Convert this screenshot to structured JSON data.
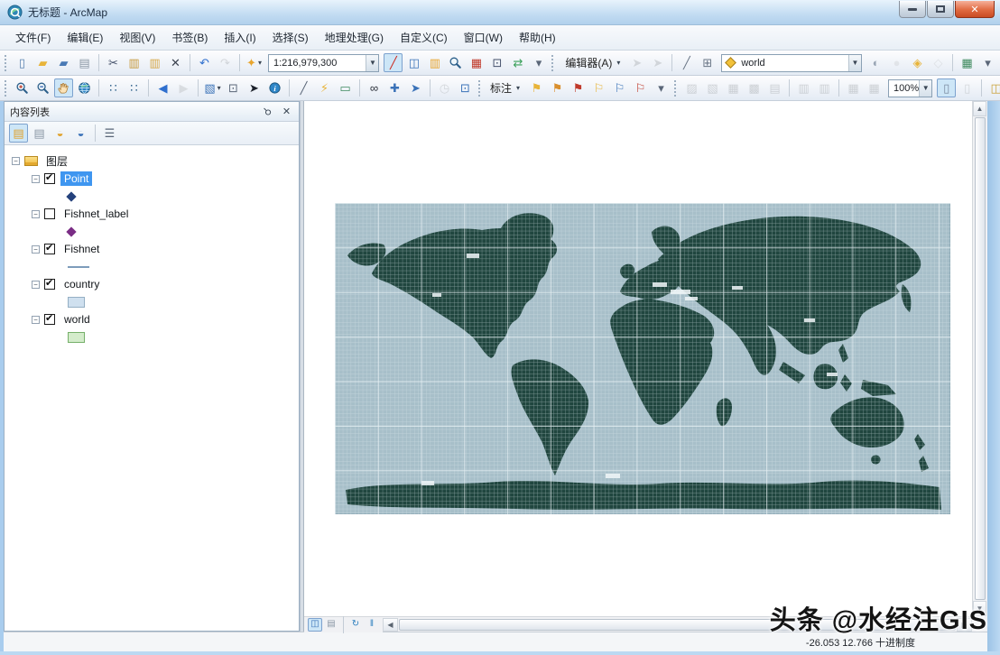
{
  "window": {
    "title": "无标题 - ArcMap"
  },
  "menu": {
    "items": [
      {
        "key": "file",
        "label": "文件(F)"
      },
      {
        "key": "edit",
        "label": "编辑(E)"
      },
      {
        "key": "view",
        "label": "视图(V)"
      },
      {
        "key": "bookmarks",
        "label": "书签(B)"
      },
      {
        "key": "insert",
        "label": "插入(I)"
      },
      {
        "key": "selection",
        "label": "选择(S)"
      },
      {
        "key": "geoprocessing",
        "label": "地理处理(G)"
      },
      {
        "key": "customize",
        "label": "自定义(C)"
      },
      {
        "key": "window",
        "label": "窗口(W)"
      },
      {
        "key": "help",
        "label": "帮助(H)"
      }
    ]
  },
  "combos": {
    "scale": "1:216,979,300",
    "editor_label": "编辑器(A)",
    "target_layer": "world",
    "labeling_label": "标注",
    "zoom_percent": "100%"
  },
  "toolbars": {
    "standard_a": [
      {
        "grip": true
      },
      {
        "n": "new-map-file",
        "g": "▯",
        "c": "#5a82b0"
      },
      {
        "n": "open-project",
        "g": "▰",
        "c": "#e8b43a"
      },
      {
        "n": "save-project",
        "g": "▰",
        "c": "#4a7ab5"
      },
      {
        "n": "print",
        "g": "▤",
        "c": "#8d99a6"
      },
      {
        "sep": true
      },
      {
        "n": "cut",
        "g": "✂",
        "c": "#44506a"
      },
      {
        "n": "copy",
        "g": "▥",
        "c": "#c79a3e"
      },
      {
        "n": "paste",
        "g": "▥",
        "c": "#d7a94a"
      },
      {
        "n": "delete",
        "g": "✕",
        "c": "#3b4250"
      },
      {
        "sep": true
      },
      {
        "n": "undo",
        "g": "↶",
        "c": "#2f6fce"
      },
      {
        "n": "redo",
        "g": "↷",
        "c": "#9aa6b5",
        "dis": true
      },
      {
        "sep": true
      },
      {
        "n": "add-data",
        "g": "✦",
        "c": "#e8a52e",
        "dd": true
      }
    ],
    "standard_b": [
      {
        "n": "edit-tool",
        "g": "╱",
        "c": "#cc2a1e",
        "sel": true
      },
      {
        "n": "toc-window",
        "g": "◫",
        "c": "#3a72b8"
      },
      {
        "n": "catalog-window",
        "g": "▥",
        "c": "#e8a52e"
      },
      {
        "n": "search-window",
        "i": "magnifier"
      },
      {
        "n": "arctoolbox-window",
        "g": "▦",
        "c": "#c03a2b"
      },
      {
        "n": "python-window",
        "g": "⊡",
        "c": "#44506a"
      },
      {
        "n": "model-builder",
        "g": "⇄",
        "c": "#3aa05a"
      },
      {
        "n": "standard-toolbar-overflow",
        "g": "▾",
        "c": "#5a6678"
      }
    ],
    "editor_a": [
      {
        "n": "edit-pointer",
        "g": "➤",
        "c": "#9aa6b5",
        "dis": true
      },
      {
        "n": "edit-annotation-tool",
        "g": "➤",
        "c": "#9aa6b5",
        "dis": true
      },
      {
        "sep": true
      },
      {
        "n": "create-line-tool",
        "g": "╱",
        "c": "#6a7686"
      },
      {
        "n": "edit-vertices-tool",
        "g": "⊞",
        "c": "#6a7686"
      }
    ],
    "editor_b": [
      {
        "n": "create-features-circle",
        "g": "◐",
        "c": "#9aa6b5"
      },
      {
        "n": "construct-points",
        "g": "●",
        "c": "#c7ced6",
        "dis": true
      },
      {
        "n": "snapping",
        "g": "◈",
        "c": "#e8b43a"
      },
      {
        "n": "sketch-properties",
        "g": "◇",
        "c": "#b9c2cc",
        "dis": true
      },
      {
        "sep": true
      },
      {
        "n": "attributes-table",
        "g": "▦",
        "c": "#3f8a5f"
      },
      {
        "n": "editor-toolbar-overflow",
        "g": "▾",
        "c": "#5a6678"
      }
    ],
    "tools": [
      {
        "grip": true
      },
      {
        "n": "zoom-in",
        "i": "magplus"
      },
      {
        "n": "zoom-out",
        "i": "magminus"
      },
      {
        "n": "pan",
        "i": "hand",
        "sel": true
      },
      {
        "n": "full-extent",
        "i": "globe"
      },
      {
        "sep": true
      },
      {
        "n": "fixed-zoom-in",
        "g": "∷",
        "c": "#2c5f8a"
      },
      {
        "n": "fixed-zoom-out",
        "g": "∷",
        "c": "#2c5f8a"
      },
      {
        "sep": true
      },
      {
        "n": "go-back-extent",
        "g": "◀",
        "c": "#2f6fce"
      },
      {
        "n": "go-forward-extent",
        "g": "▶",
        "c": "#aeb8c4",
        "dis": true
      },
      {
        "sep": true
      },
      {
        "n": "select-features",
        "g": "▧",
        "c": "#3a72b8",
        "dd": true
      },
      {
        "n": "clear-selected-features",
        "g": "⊡",
        "c": "#5a6678"
      },
      {
        "n": "select-elements",
        "g": "➤",
        "c": "#1c212b"
      },
      {
        "n": "identify",
        "i": "identify"
      },
      {
        "sep": true
      },
      {
        "n": "measure",
        "g": "╱",
        "c": "#5a6678"
      },
      {
        "n": "hyperlink",
        "g": "⚡",
        "c": "#e8b43a"
      },
      {
        "n": "html-popup",
        "g": "▭",
        "c": "#3f8a5f"
      },
      {
        "sep": true
      },
      {
        "n": "find",
        "g": "∞",
        "c": "#2b303a"
      },
      {
        "n": "find-route",
        "g": "✚",
        "c": "#3a72b8"
      },
      {
        "n": "go-to-xy",
        "g": "➤",
        "c": "#3a72b8"
      },
      {
        "sep": true
      },
      {
        "n": "time-slider",
        "g": "◷",
        "c": "#9aa6b5",
        "dis": true
      },
      {
        "n": "create-viewer-window",
        "g": "⊡",
        "c": "#3a72b8"
      }
    ],
    "labeling": [
      {
        "n": "label-manager",
        "g": "⚑",
        "c": "#e8b43a"
      },
      {
        "n": "label-priority-ranking",
        "g": "⚑",
        "c": "#d98f2e"
      },
      {
        "n": "label-weight-ranking",
        "g": "⚑",
        "c": "#c03a2b"
      },
      {
        "n": "lock-labels",
        "g": "⚐",
        "c": "#e8b43a"
      },
      {
        "n": "view-unplaced-labels",
        "g": "⚐",
        "c": "#3a72b8"
      },
      {
        "n": "pause-labeling",
        "g": "⚐",
        "c": "#c03a2b"
      },
      {
        "n": "labeling-toolbar-overflow",
        "g": "▾",
        "c": "#5a6678"
      }
    ],
    "extras_a": [
      {
        "grip": true
      },
      {
        "n": "topology-edit-tool",
        "g": "▨",
        "c": "#8a97a5",
        "dis": true
      },
      {
        "n": "topology-fix-error",
        "g": "▧",
        "c": "#8a97a5",
        "dis": true
      },
      {
        "n": "topology-error-inspector",
        "g": "▦",
        "c": "#8a97a5",
        "dis": true
      },
      {
        "n": "topology-validate",
        "g": "▩",
        "c": "#8a97a5",
        "dis": true
      },
      {
        "n": "topology-map",
        "g": "▤",
        "c": "#8a97a5",
        "dis": true
      },
      {
        "sep": true
      },
      {
        "n": "graphics-align",
        "g": "▥",
        "c": "#8a97a5",
        "dis": true
      },
      {
        "n": "graphics-distribute",
        "g": "▥",
        "c": "#8a97a5",
        "dis": true
      },
      {
        "sep": true
      },
      {
        "n": "raster-paint",
        "g": "▦",
        "c": "#8a97a5",
        "dis": true
      },
      {
        "n": "raster-brush",
        "g": "▦",
        "c": "#8a97a5",
        "dis": true
      }
    ],
    "extras_b": [
      {
        "n": "pause-drawing-page",
        "g": "▯",
        "c": "#7a8aa0",
        "sel": true
      },
      {
        "n": "page-definition",
        "g": "▯",
        "c": "#9aa6b5",
        "dis": true
      },
      {
        "sep": true
      },
      {
        "n": "data-frame-lock",
        "g": "◫",
        "c": "#caa23a"
      },
      {
        "n": "data-frame-refresh",
        "g": "◉",
        "c": "#3a72b8"
      },
      {
        "n": "tools-toolbar-overflow",
        "g": "▾",
        "c": "#5a6678"
      }
    ],
    "toc": [
      {
        "n": "list-by-drawing-order",
        "g": "▤",
        "c": "#e0a32e",
        "sel": true
      },
      {
        "n": "list-by-source",
        "g": "▤",
        "c": "#8a97a5"
      },
      {
        "n": "list-by-visibility",
        "g": "◒",
        "c": "#e0a32e"
      },
      {
        "n": "list-by-selection",
        "g": "◒",
        "c": "#3a72b8"
      },
      {
        "sep": true
      },
      {
        "n": "toc-options",
        "g": "☰",
        "c": "#5a6678"
      }
    ],
    "viewbar": [
      {
        "n": "data-view-button",
        "g": "◫",
        "c": "#3a72b8",
        "sel": true
      },
      {
        "n": "layout-view-button",
        "g": "▤",
        "c": "#8a97a5"
      },
      {
        "sep": true
      },
      {
        "n": "refresh-view-button",
        "g": "↻",
        "c": "#2c7fbf"
      },
      {
        "n": "pause-drawing-button",
        "g": "‖",
        "c": "#2c7fbf"
      }
    ]
  },
  "toc": {
    "title": "内容列表",
    "root": "图层",
    "layers": [
      {
        "name": "Point",
        "checked": true,
        "selected": true,
        "symbol": {
          "type": "diamond",
          "color": "#24417c"
        }
      },
      {
        "name": "Fishnet_label",
        "checked": false,
        "selected": false,
        "symbol": {
          "type": "diamond",
          "color": "#7a2d85"
        }
      },
      {
        "name": "Fishnet",
        "checked": true,
        "selected": false,
        "symbol": {
          "type": "line",
          "color": "#7d9cbb"
        }
      },
      {
        "name": "country",
        "checked": true,
        "selected": false,
        "symbol": {
          "type": "fill",
          "color": "#cfe0ef",
          "outline": "#94afc4"
        }
      },
      {
        "name": "world",
        "checked": true,
        "selected": false,
        "symbol": {
          "type": "fill",
          "color": "#d4eccb",
          "outline": "#76b06a"
        }
      }
    ]
  },
  "map": {
    "ocean_color": "#a7bfc9",
    "land_color": "#20463f",
    "grid_color": "#e8f1f5"
  },
  "statusbar": {
    "coordinates": "-26.053  12.766 十进制度"
  },
  "watermark": {
    "text": "头条 @水经注GIS"
  }
}
